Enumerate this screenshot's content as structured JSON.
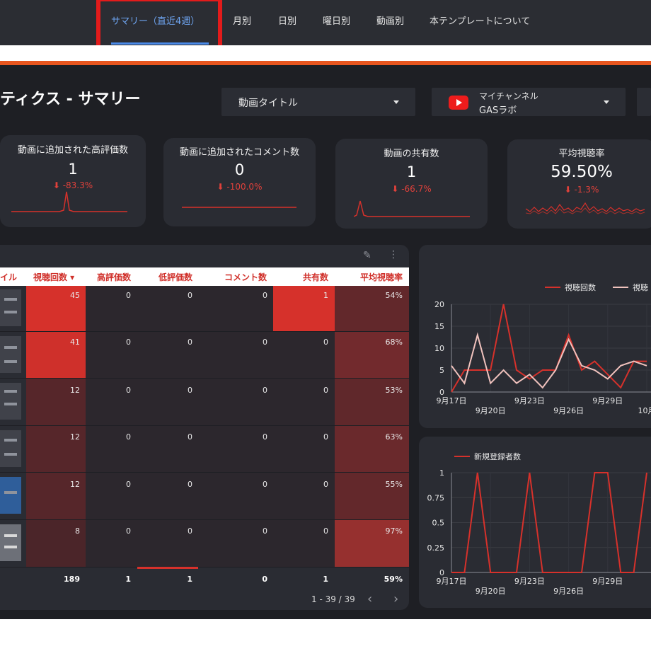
{
  "nav": {
    "tabs": [
      {
        "label": "サマリー（直近4週）",
        "active": true
      },
      {
        "label": "月別"
      },
      {
        "label": "日別"
      },
      {
        "label": "曜日別"
      },
      {
        "label": "動画別"
      },
      {
        "label": "本テンプレートについて"
      }
    ]
  },
  "header": {
    "title": "ティクス - サマリー",
    "video_filter_label": "動画タイトル",
    "channel_label": "マイチャンネル",
    "channel_name": "GASラボ"
  },
  "kpis": [
    {
      "label": "動画に追加された高評価数",
      "value": "1",
      "delta": "⬇ -83.3%"
    },
    {
      "label": "動画に追加されたコメント数",
      "value": "0",
      "delta": "⬇ -100.0%"
    },
    {
      "label": "動画の共有数",
      "value": "1",
      "delta": "⬇ -66.7%"
    },
    {
      "label": "平均視聴率",
      "value": "59.50%",
      "delta": "⬇ -1.3%"
    }
  ],
  "table": {
    "columns": [
      "イル",
      "視聴回数 ▾",
      "高評価数",
      "低評価数",
      "コメント数",
      "共有数",
      "平均視聴率"
    ],
    "rows": [
      [
        "45",
        "0",
        "0",
        "0",
        "1",
        "54%"
      ],
      [
        "41",
        "0",
        "0",
        "0",
        "0",
        "68%"
      ],
      [
        "12",
        "0",
        "0",
        "0",
        "0",
        "53%"
      ],
      [
        "12",
        "0",
        "0",
        "0",
        "0",
        "63%"
      ],
      [
        "12",
        "0",
        "0",
        "0",
        "0",
        "55%"
      ],
      [
        "8",
        "0",
        "0",
        "0",
        "0",
        "97%"
      ]
    ],
    "totals": [
      "189",
      "1",
      "1",
      "0",
      "1",
      "59%"
    ],
    "pagination": "1 - 39 / 39"
  },
  "colors": {
    "accent": "#d6312b",
    "nav_active": "#6ea4f0",
    "orange": "#e8561f",
    "highlight": "#e31b1b"
  },
  "chart_data": [
    {
      "type": "line",
      "x": [
        "9月17日",
        "9月18日",
        "9月19日",
        "9月20日",
        "9月21日",
        "9月22日",
        "9月23日",
        "9月24日",
        "9月25日",
        "9月26日",
        "9月27日",
        "9月28日",
        "9月29日",
        "9月30日",
        "10月1日",
        "10月2日"
      ],
      "x_ticks": [
        "9月17日",
        "9月20日",
        "9月23日",
        "9月26日",
        "9月29日",
        "10月"
      ],
      "series": [
        {
          "name": "視聴回数",
          "values": [
            0,
            5,
            5,
            5,
            20,
            5,
            3,
            5,
            5,
            13,
            5,
            7,
            4,
            1,
            7,
            7
          ]
        },
        {
          "name": "視聴",
          "values": [
            6,
            2,
            13,
            2,
            5,
            2,
            4,
            1,
            5,
            12,
            6,
            5,
            3,
            6,
            7,
            6
          ]
        }
      ],
      "ylim": [
        0,
        20
      ],
      "yticks": [
        0,
        5,
        10,
        15,
        20
      ]
    },
    {
      "type": "line",
      "x": [
        "9月17日",
        "9月18日",
        "9月19日",
        "9月20日",
        "9月21日",
        "9月22日",
        "9月23日",
        "9月24日",
        "9月25日",
        "9月26日",
        "9月27日",
        "9月28日",
        "9月29日",
        "9月30日",
        "10月1日",
        "10月2日"
      ],
      "x_ticks": [
        "9月17日",
        "9月20日",
        "9月23日",
        "9月26日",
        "9月29日"
      ],
      "series": [
        {
          "name": "新規登録者数",
          "values": [
            0,
            0,
            1,
            0,
            0,
            0,
            1,
            0,
            0,
            0,
            0,
            1,
            1,
            0,
            0,
            1
          ]
        }
      ],
      "ylim": [
        0,
        1
      ],
      "yticks": [
        0,
        0.25,
        0.5,
        0.75,
        1
      ]
    }
  ]
}
